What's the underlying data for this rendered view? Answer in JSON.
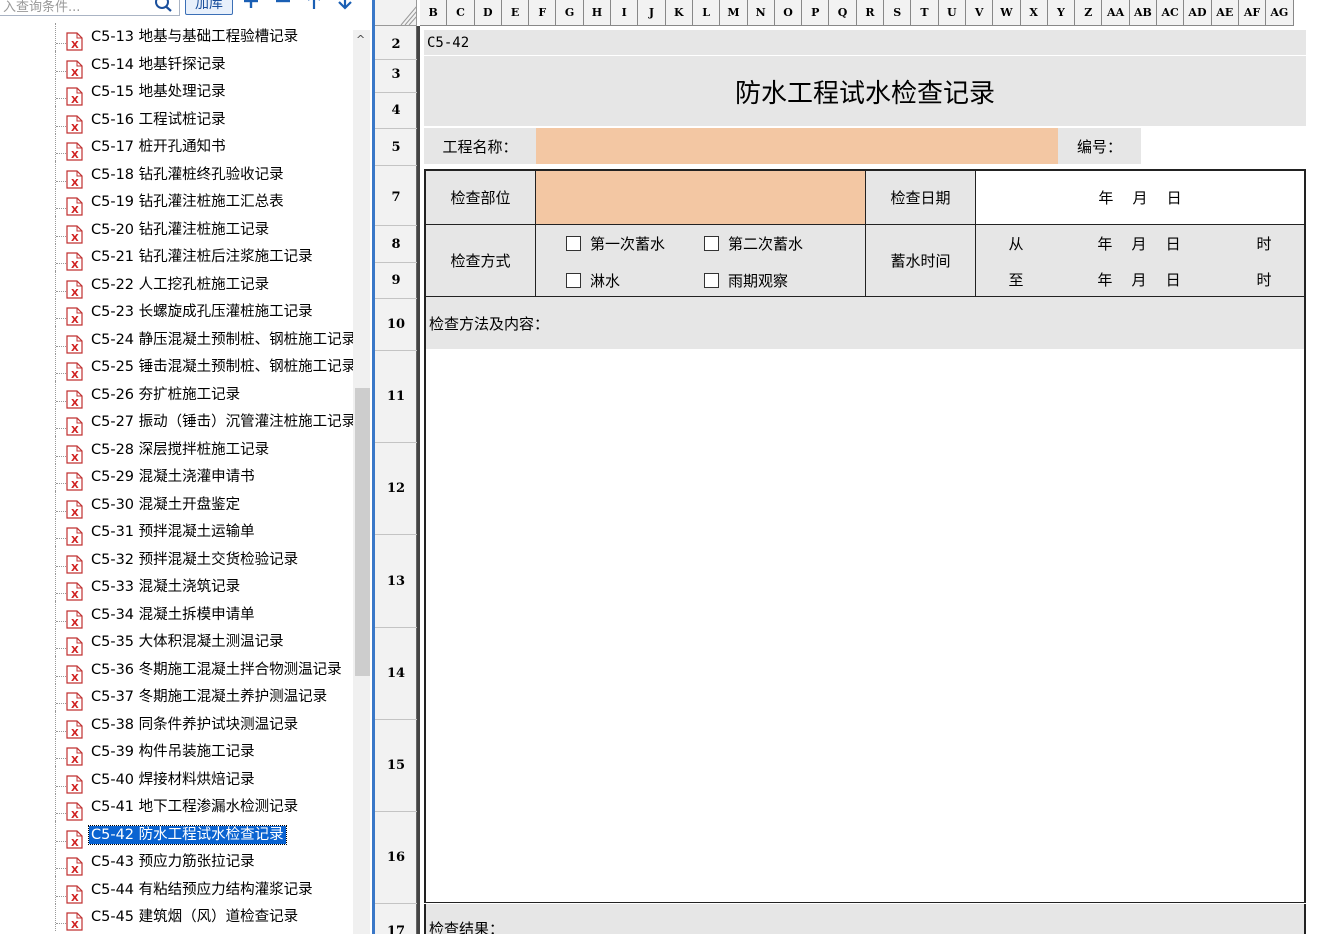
{
  "toolbar": {
    "search_placeholder": "入查询条件...",
    "add_library": "加库",
    "icons": [
      "search-icon",
      "plus-icon",
      "minus-icon",
      "arrow-up-icon",
      "arrow-down-icon"
    ]
  },
  "tree": {
    "items": [
      "C5-13 地基与基础工程验槽记录",
      "C5-14 地基钎探记录",
      "C5-15 地基处理记录",
      "C5-16 工程试桩记录",
      "C5-17 桩开孔通知书",
      "C5-18 钻孔灌桩终孔验收记录",
      "C5-19 钻孔灌注桩施工汇总表",
      "C5-20 钻孔灌注桩施工记录",
      "C5-21 钻孔灌注桩后注浆施工记录",
      "C5-22 人工挖孔桩施工记录",
      "C5-23 长螺旋成孔压灌桩施工记录",
      "C5-24 静压混凝土预制桩、钢桩施工记录",
      "C5-25 锤击混凝土预制桩、钢桩施工记录",
      "C5-26 夯扩桩施工记录",
      "C5-27 振动（锤击）沉管灌注桩施工记录",
      "C5-28 深层搅拌桩施工记录",
      "C5-29 混凝土浇灌申请书",
      "C5-30 混凝土开盘鉴定",
      "C5-31 预拌混凝土运输单",
      "C5-32 预拌混凝土交货检验记录",
      "C5-33 混凝土浇筑记录",
      "C5-34 混凝土拆模申请单",
      "C5-35 大体积混凝土测温记录",
      "C5-36 冬期施工混凝土拌合物测温记录",
      "C5-37 冬期施工混凝土养护测温记录",
      "C5-38 同条件养护试块测温记录",
      "C5-39 构件吊装施工记录",
      "C5-40 焊接材料烘焙记录",
      "C5-41 地下工程渗漏水检测记录",
      "C5-42 防水工程试水检查记录",
      "C5-43 预应力筋张拉记录",
      "C5-44 有粘结预应力结构灌浆记录",
      "C5-45 建筑烟（风）道检查记录"
    ],
    "selected_index": 29
  },
  "sheet": {
    "columns": [
      "B",
      "C",
      "D",
      "E",
      "F",
      "G",
      "H",
      "I",
      "J",
      "K",
      "L",
      "M",
      "N",
      "O",
      "P",
      "Q",
      "R",
      "S",
      "T",
      "U",
      "V",
      "W",
      "X",
      "Y",
      "Z",
      "AA",
      "AB",
      "AC",
      "AD",
      "AE",
      "AF",
      "AG"
    ],
    "rows": [
      "2",
      "3",
      "4",
      "5",
      "7",
      "8",
      "9",
      "10",
      "11",
      "12",
      "13",
      "14",
      "15",
      "16",
      "17"
    ]
  },
  "form": {
    "code": "C5-42",
    "title": "防水工程试水检查记录",
    "project_name_label": "工程名称：",
    "project_name_value": "",
    "number_label": "编号：",
    "number_value": "",
    "inspect_part_label": "检查部位",
    "inspect_date_label": "检查日期",
    "date_text": "年    月    日",
    "inspect_method_label": "检查方式",
    "checkbox_first": "第一次蓄水",
    "checkbox_second": "第二次蓄水",
    "checkbox_sprinkle": "淋水",
    "checkbox_rain": "雨期观察",
    "storage_time_label": "蓄水时间",
    "from_label": "从",
    "to_label": "至",
    "ymd_text": "年    月    日",
    "hour_label": "时",
    "method_content_label": "检查方法及内容：",
    "result_label": "检查结果："
  }
}
